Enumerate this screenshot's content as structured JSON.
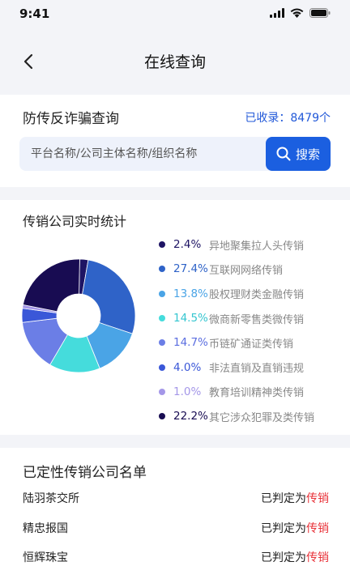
{
  "status_bar": {
    "time": "9:41"
  },
  "nav": {
    "title": "在线查询"
  },
  "search": {
    "title": "防传反诈骗查询",
    "count_label": "已收录：8479个",
    "placeholder": "平台名称/公司主体名称/组织名称",
    "button_label": "搜索"
  },
  "stats": {
    "title": "传销公司实时统计",
    "items": [
      {
        "pct": "2.4%",
        "label": "异地聚集拉人头传销",
        "color": "#1e1464",
        "text_color": "#1e1464"
      },
      {
        "pct": "27.4%",
        "label": "互联网网络传销",
        "color": "#2f63c8",
        "text_color": "#2f63c8"
      },
      {
        "pct": "13.8%",
        "label": "股权理财类金融传销",
        "color": "#4aa4e6",
        "text_color": "#4aa4e6"
      },
      {
        "pct": "14.5%",
        "label": "微商新零售类微传销",
        "color": "#45dcdc",
        "text_color": "#35c6d0"
      },
      {
        "pct": "14.7%",
        "label": "币链矿通证类传销",
        "color": "#6b7ee6",
        "text_color": "#5b6ee0"
      },
      {
        "pct": "4.0%",
        "label": "非法直销及直销违规",
        "color": "#3a57d8",
        "text_color": "#3a57d8"
      },
      {
        "pct": "1.0%",
        "label": "教育培训精神类传销",
        "color": "#a497e8",
        "text_color": "#a497e8"
      },
      {
        "pct": "22.2%",
        "label": "其它涉众犯罪及类传销",
        "color": "#180c52",
        "text_color": "#180c52"
      }
    ]
  },
  "chart_data": {
    "type": "pie",
    "donut": true,
    "categories": [
      "异地聚集拉人头传销",
      "互联网网络传销",
      "股权理财类金融传销",
      "微商新零售类微传销",
      "币链矿通证类传销",
      "非法直销及直销违规",
      "教育培训精神类传销",
      "其它涉众犯罪及类传销"
    ],
    "values": [
      2.4,
      27.4,
      13.8,
      14.5,
      14.7,
      4.0,
      1.0,
      22.2
    ],
    "colors": [
      "#1e1464",
      "#2f63c8",
      "#4aa4e6",
      "#45dcdc",
      "#6b7ee6",
      "#3a57d8",
      "#a497e8",
      "#180c52"
    ],
    "title": "传销公司实时统计"
  },
  "list": {
    "title": "已定性传销公司名单",
    "status_prefix": "已判定为",
    "status_tag": "传销",
    "rows": [
      {
        "name": "陆羽茶交所"
      },
      {
        "name": "精忠报国"
      },
      {
        "name": "恒辉珠宝"
      }
    ]
  }
}
